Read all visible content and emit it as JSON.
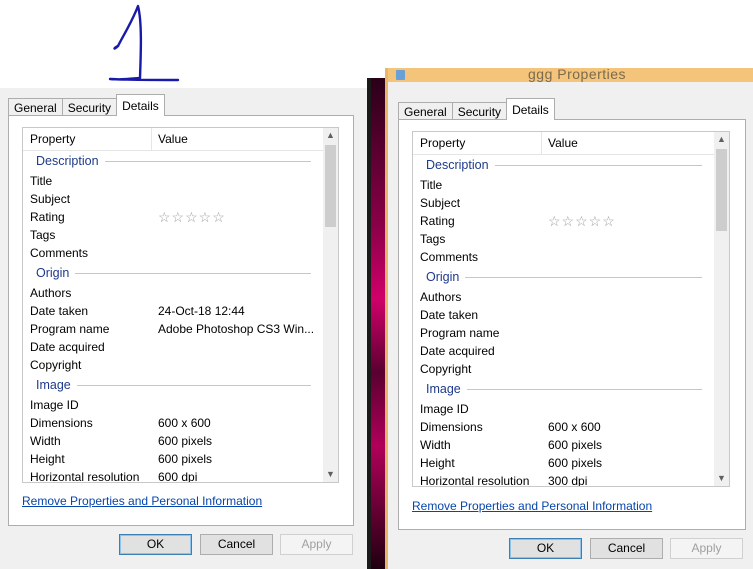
{
  "windows": [
    {
      "id": "left",
      "title": "",
      "tabs": [
        "General",
        "Security",
        "Details"
      ],
      "active_tab": "Details",
      "columns": {
        "property": "Property",
        "value": "Value"
      },
      "rows": [
        {
          "type": "group",
          "label": "Description"
        },
        {
          "type": "item",
          "property": "Title",
          "value": ""
        },
        {
          "type": "item",
          "property": "Subject",
          "value": ""
        },
        {
          "type": "rating",
          "property": "Rating",
          "value": "☆☆☆☆☆"
        },
        {
          "type": "item",
          "property": "Tags",
          "value": ""
        },
        {
          "type": "item",
          "property": "Comments",
          "value": ""
        },
        {
          "type": "group",
          "label": "Origin"
        },
        {
          "type": "item",
          "property": "Authors",
          "value": ""
        },
        {
          "type": "item",
          "property": "Date taken",
          "value": "24-Oct-18 12:44"
        },
        {
          "type": "item",
          "property": "Program name",
          "value": "Adobe Photoshop CS3 Win..."
        },
        {
          "type": "item",
          "property": "Date acquired",
          "value": ""
        },
        {
          "type": "item",
          "property": "Copyright",
          "value": ""
        },
        {
          "type": "group",
          "label": "Image"
        },
        {
          "type": "item",
          "property": "Image ID",
          "value": ""
        },
        {
          "type": "item",
          "property": "Dimensions",
          "value": "600 x 600"
        },
        {
          "type": "item",
          "property": "Width",
          "value": "600 pixels"
        },
        {
          "type": "item",
          "property": "Height",
          "value": "600 pixels"
        },
        {
          "type": "item",
          "property": "Horizontal resolution",
          "value": "600 dpi"
        }
      ],
      "link": "Remove Properties and Personal Information",
      "buttons": {
        "ok": "OK",
        "cancel": "Cancel",
        "apply": "Apply"
      }
    },
    {
      "id": "right",
      "title": "ggg Properties",
      "tabs": [
        "General",
        "Security",
        "Details"
      ],
      "active_tab": "Details",
      "columns": {
        "property": "Property",
        "value": "Value"
      },
      "rows": [
        {
          "type": "group",
          "label": "Description"
        },
        {
          "type": "item",
          "property": "Title",
          "value": ""
        },
        {
          "type": "item",
          "property": "Subject",
          "value": ""
        },
        {
          "type": "rating",
          "property": "Rating",
          "value": "☆☆☆☆☆"
        },
        {
          "type": "item",
          "property": "Tags",
          "value": ""
        },
        {
          "type": "item",
          "property": "Comments",
          "value": ""
        },
        {
          "type": "group",
          "label": "Origin"
        },
        {
          "type": "item",
          "property": "Authors",
          "value": ""
        },
        {
          "type": "item",
          "property": "Date taken",
          "value": ""
        },
        {
          "type": "item",
          "property": "Program name",
          "value": ""
        },
        {
          "type": "item",
          "property": "Date acquired",
          "value": ""
        },
        {
          "type": "item",
          "property": "Copyright",
          "value": ""
        },
        {
          "type": "group",
          "label": "Image"
        },
        {
          "type": "item",
          "property": "Image ID",
          "value": ""
        },
        {
          "type": "item",
          "property": "Dimensions",
          "value": "600 x 600"
        },
        {
          "type": "item",
          "property": "Width",
          "value": "600 pixels"
        },
        {
          "type": "item",
          "property": "Height",
          "value": "600 pixels"
        },
        {
          "type": "item",
          "property": "Horizontal resolution",
          "value": "300 dpi"
        }
      ],
      "link": "Remove Properties and Personal Information",
      "buttons": {
        "ok": "OK",
        "cancel": "Cancel",
        "apply": "Apply"
      }
    }
  ],
  "colors": {
    "group_text": "#1e3a8a",
    "link": "#0645ad",
    "annotation_ink": "#1a1aa8"
  },
  "icons": {
    "scroll_up": "chevron-up-icon",
    "scroll_down": "chevron-down-icon",
    "rating": "star-outline-icon"
  }
}
